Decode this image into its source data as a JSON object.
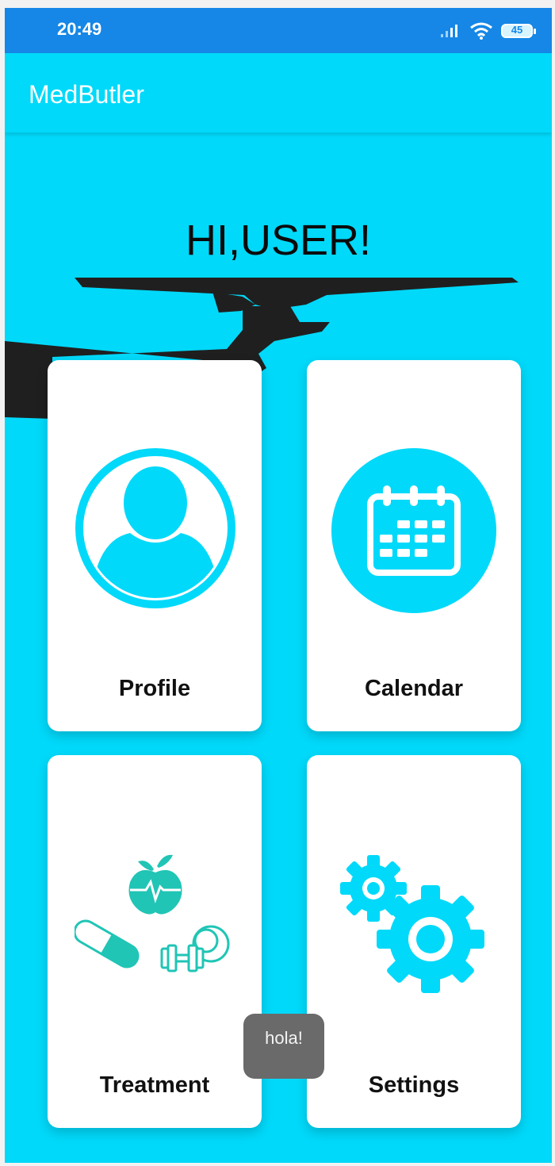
{
  "status_bar": {
    "time": "20:49",
    "battery": "45",
    "icons": [
      "signal-icon",
      "wifi-icon",
      "battery-icon"
    ]
  },
  "app_bar": {
    "title": "MedButler"
  },
  "greeting": "HI,USER!",
  "cards": {
    "profile": {
      "label": "Profile",
      "icon": "person-icon"
    },
    "calendar": {
      "label": "Calendar",
      "icon": "calendar-icon"
    },
    "treatment": {
      "label": "Treatment",
      "icon": "treatment-icon"
    },
    "settings": {
      "label": "Settings",
      "icon": "gears-icon"
    }
  },
  "toast": "hola!",
  "colors": {
    "accent": "#00d9fa",
    "status_bar": "#1687e6",
    "treatment_teal": "#20c5b5",
    "tray": "#1f1f1f"
  }
}
